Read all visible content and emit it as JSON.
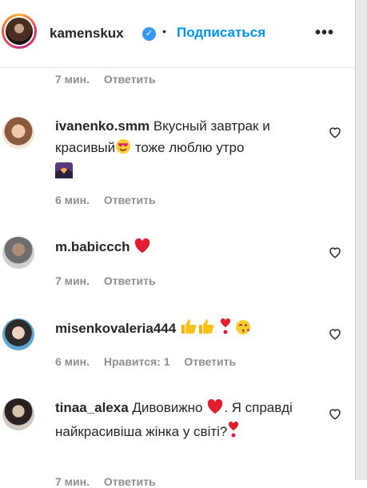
{
  "header": {
    "username": "kamenskux",
    "dot": "•",
    "follow_label": "Подписаться",
    "more_label": "•••"
  },
  "top_meta": {
    "time": "7 мин.",
    "reply": "Ответить"
  },
  "comments": [
    {
      "username": "ivanenko.smm",
      "text_before": "Вкусный завтрак и красивый",
      "text_after": " тоже люблю утро",
      "time": "6 мин.",
      "reply": "Ответить"
    },
    {
      "username": "m.babicсch",
      "time": "7 мин.",
      "reply": "Ответить"
    },
    {
      "username": "misenkovaleria444",
      "time": "6 мин.",
      "likes": "Нравится: 1",
      "reply": "Ответить"
    },
    {
      "username": "tinaa_alexa",
      "text_before": "Дивовижно",
      "text_after": ". Я справді найкрасивіша жінка у світі?",
      "time": "7 мин.",
      "reply": "Ответить"
    }
  ]
}
